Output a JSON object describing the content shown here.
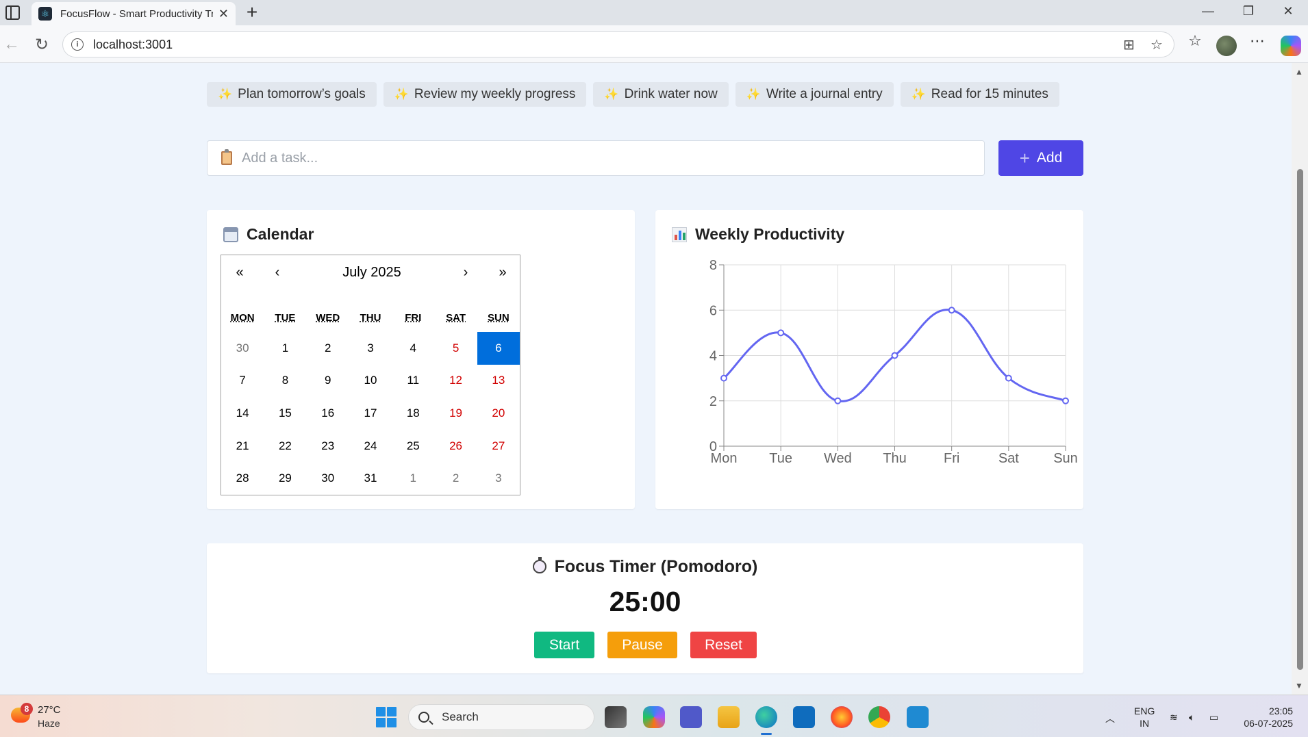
{
  "browser": {
    "tab_title": "FocusFlow - Smart Productivity Tr",
    "url": "localhost:3001"
  },
  "suggestions": [
    "Plan tomorrow’s goals",
    "Review my weekly progress",
    "Drink water now",
    "Write a journal entry",
    "Read for 15 minutes"
  ],
  "task_input": {
    "placeholder": "Add a task...",
    "add_label": "Add"
  },
  "calendar": {
    "title": "Calendar",
    "month_label": "July 2025",
    "nav": {
      "prev2": "«",
      "prev": "‹",
      "next": "›",
      "next2": "»"
    },
    "weekdays": [
      "MON",
      "TUE",
      "WED",
      "THU",
      "FRI",
      "SAT",
      "SUN"
    ],
    "days": [
      [
        "30",
        "1",
        "2",
        "3",
        "4",
        "5",
        "6"
      ],
      [
        "7",
        "8",
        "9",
        "10",
        "11",
        "12",
        "13"
      ],
      [
        "14",
        "15",
        "16",
        "17",
        "18",
        "19",
        "20"
      ],
      [
        "21",
        "22",
        "23",
        "24",
        "25",
        "26",
        "27"
      ],
      [
        "28",
        "29",
        "30",
        "31",
        "1",
        "2",
        "3"
      ]
    ],
    "selected_day": "6"
  },
  "weekly": {
    "title": "Weekly Productivity"
  },
  "chart_data": {
    "type": "line",
    "categories": [
      "Mon",
      "Tue",
      "Wed",
      "Thu",
      "Fri",
      "Sat",
      "Sun"
    ],
    "series": [
      {
        "values": [
          3,
          5,
          2,
          4,
          6,
          3,
          2
        ]
      }
    ],
    "ylim": [
      0,
      8
    ],
    "yticks": [
      0,
      2,
      4,
      6,
      8
    ],
    "grid": true,
    "color": "#6366f1"
  },
  "timer": {
    "title": "Focus Timer (Pomodoro)",
    "value": "25:00",
    "start_label": "Start",
    "pause_label": "Pause",
    "reset_label": "Reset",
    "colors": {
      "start": "#10b981",
      "pause": "#f59e0b",
      "reset": "#ef4444"
    }
  },
  "taskbar": {
    "temp": "27°C",
    "weather": "Haze",
    "weather_badge": "8",
    "search_label": "Search",
    "lang_1": "ENG",
    "lang_2": "IN",
    "time": "23:05",
    "date": "06-07-2025"
  }
}
